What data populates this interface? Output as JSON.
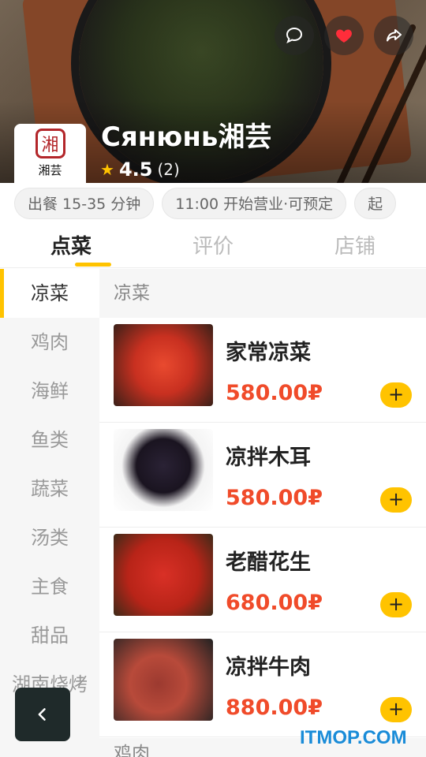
{
  "store": {
    "name": "Сянюнь湘芸",
    "rating": "4.5",
    "rating_count": "(2)",
    "logo_text": "湘芸",
    "logo_seal": "湘"
  },
  "info_chips": [
    "出餐 15-35 分钟",
    "11:00 开始营业·可预定",
    "起"
  ],
  "tabs": [
    {
      "label": "点菜",
      "active": true
    },
    {
      "label": "评价",
      "active": false
    },
    {
      "label": "店铺",
      "active": false
    }
  ],
  "categories": [
    {
      "label": "凉菜",
      "active": true
    },
    {
      "label": "鸡肉",
      "active": false
    },
    {
      "label": "海鲜",
      "active": false
    },
    {
      "label": "鱼类",
      "active": false
    },
    {
      "label": "蔬菜",
      "active": false
    },
    {
      "label": "汤类",
      "active": false
    },
    {
      "label": "主食",
      "active": false
    },
    {
      "label": "甜品",
      "active": false
    },
    {
      "label": "湖南烧烤",
      "active": false
    }
  ],
  "menu": {
    "section_title": "凉菜",
    "next_section_title": "鸡肉",
    "items": [
      {
        "name": "家常凉菜",
        "price": "580.00₽"
      },
      {
        "name": "凉拌木耳",
        "price": "580.00₽"
      },
      {
        "name": "老醋花生",
        "price": "680.00₽"
      },
      {
        "name": "凉拌牛肉",
        "price": "880.00₽"
      }
    ],
    "add_label": "+"
  },
  "watermark": "ITMOP.COM",
  "icons": {
    "comment": "comment-icon",
    "favorite": "heart-icon",
    "share": "share-icon",
    "back": "chevron-left-icon",
    "star": "star-icon"
  },
  "colors": {
    "accent": "#ffc300",
    "price": "#f04b2a",
    "favorite": "#ff2d3a"
  }
}
